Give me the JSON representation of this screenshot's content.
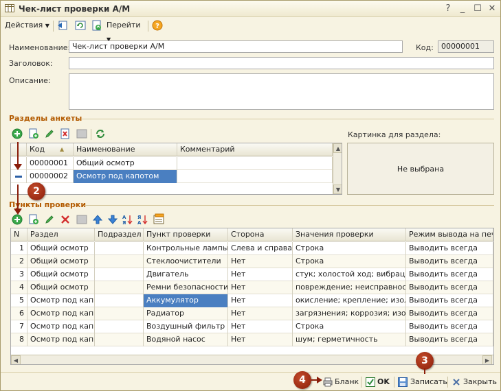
{
  "window": {
    "title": "Чек-лист проверки А/М"
  },
  "toolbar": {
    "actions_label": "Действия",
    "goto_label": "Перейти"
  },
  "form": {
    "name_label": "Наименование:",
    "name_value": "Чек-лист проверки А/М",
    "code_label": "Код:",
    "code_value": "00000001",
    "header_label": "Заголовок:",
    "header_value": "",
    "description_label": "Описание:",
    "description_value": ""
  },
  "sections": {
    "title": "Разделы анкеты",
    "columns": [
      "Код",
      "Наименование",
      "Комментарий"
    ],
    "rows": [
      {
        "code": "00000001",
        "name": "Общий осмотр",
        "comment": ""
      },
      {
        "code": "00000002",
        "name": "Осмотр под капотом",
        "comment": ""
      }
    ],
    "picture_label": "Картинка для раздела:",
    "picture_value": "Не выбрана"
  },
  "checks": {
    "title": "Пункты проверки",
    "columns": [
      "N",
      "Раздел",
      "Подраздел",
      "Пункт проверки",
      "Сторона",
      "Значения проверки",
      "Режим вывода на печ"
    ],
    "rows": [
      {
        "n": "1",
        "section": "Общий осмотр",
        "subsection": "",
        "item": "Контрольные лампы",
        "side": "Слева и справа",
        "values": "Строка",
        "mode": "Выводить всегда"
      },
      {
        "n": "2",
        "section": "Общий осмотр",
        "subsection": "",
        "item": "Стеклоочистители",
        "side": "Нет",
        "values": "Строка",
        "mode": "Выводить всегда"
      },
      {
        "n": "3",
        "section": "Общий осмотр",
        "subsection": "",
        "item": "Двигатель",
        "side": "Нет",
        "values": "стук; холостой ход; вибрация;...",
        "mode": "Выводить всегда"
      },
      {
        "n": "4",
        "section": "Общий осмотр",
        "subsection": "",
        "item": "Ремни безопасности",
        "side": "Нет",
        "values": "повреждение; неисправность",
        "mode": "Выводить всегда"
      },
      {
        "n": "5",
        "section": "Осмотр под кап...",
        "subsection": "",
        "item": "Аккумулятор",
        "side": "Нет",
        "values": "окисление; крепление; изол...",
        "mode": "Выводить всегда"
      },
      {
        "n": "6",
        "section": "Осмотр под кап...",
        "subsection": "",
        "item": "Радиатор",
        "side": "Нет",
        "values": "загрязнения; коррозия; изол...",
        "mode": "Выводить всегда"
      },
      {
        "n": "7",
        "section": "Осмотр под кап...",
        "subsection": "",
        "item": "Воздушный фильтр",
        "side": "Нет",
        "values": "Строка",
        "mode": "Выводить всегда"
      },
      {
        "n": "8",
        "section": "Осмотр под кап...",
        "subsection": "",
        "item": "Водяной насос",
        "side": "Нет",
        "values": "шум; герметичность",
        "mode": "Выводить всегда"
      }
    ]
  },
  "bottom": {
    "blank_label": "Бланк",
    "ok_label": "OK",
    "save_label": "Записать",
    "close_label": "Закрыть"
  },
  "badges": [
    "2",
    "3",
    "4"
  ],
  "colors": {
    "section_title": "#b25a00",
    "selection": "#4a7fc1",
    "badge": "#8a1d0a"
  }
}
